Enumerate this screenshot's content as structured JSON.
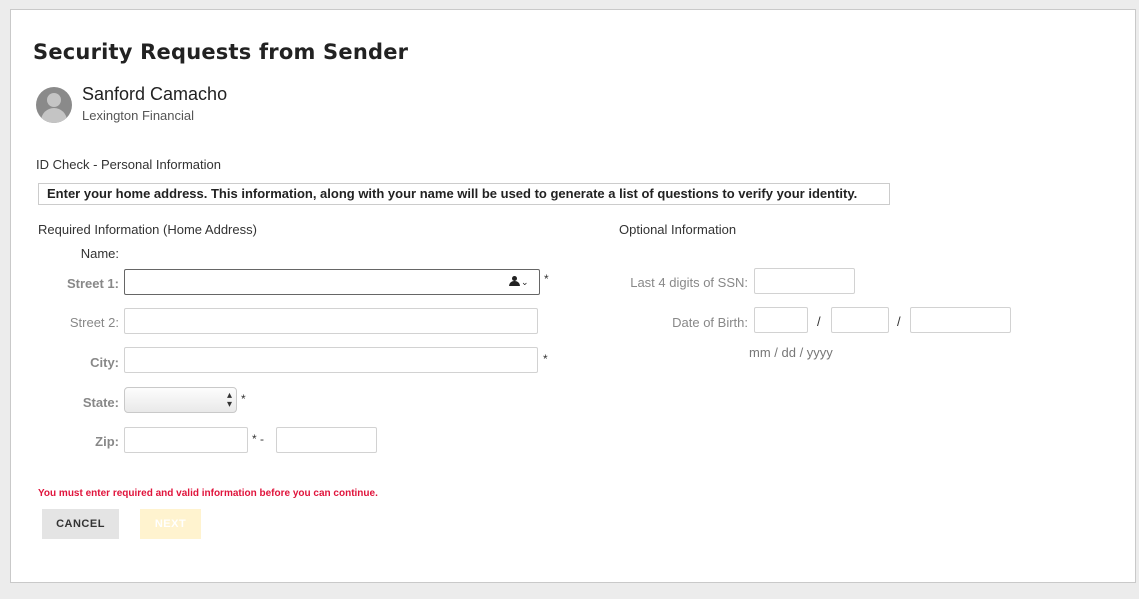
{
  "title": "Security Requests from Sender",
  "sender": {
    "name": "Sanford Camacho",
    "company": "Lexington Financial"
  },
  "section_title": "ID Check - Personal Information",
  "instruction": "Enter your home address. This information, along with your name will be used to generate a list of questions to verify your identity.",
  "required": {
    "heading": "Required Information (Home Address)",
    "name_label": "Name:",
    "street1_label": "Street 1:",
    "street2_label": "Street 2:",
    "city_label": "City:",
    "state_label": "State:",
    "zip_label": "Zip:",
    "required_marker": "*",
    "zip_required_marker": "* -",
    "street1_value": "",
    "street2_value": "",
    "city_value": "",
    "state_value": "",
    "zip_value": "",
    "zip_ext_value": ""
  },
  "optional": {
    "heading": "Optional Information",
    "ssn_label": "Last 4 digits of SSN:",
    "dob_label": "Date of Birth:",
    "date_separator": "/",
    "date_format_hint": "mm / dd / yyyy"
  },
  "error_message": "You must enter required and valid information before you can continue.",
  "buttons": {
    "cancel": "CANCEL",
    "next": "NEXT"
  },
  "icons": {
    "autofill": "person-icon",
    "state_select": "select-arrows-icon"
  },
  "colors": {
    "error": "#e0143c",
    "next_disabled_bg": "#fff3cf",
    "cancel_bg": "#e4e4e4"
  }
}
